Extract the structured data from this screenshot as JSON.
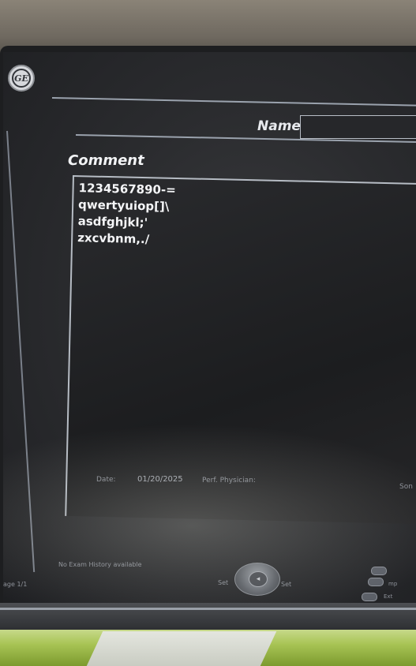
{
  "header": {
    "name_label": "Name",
    "name_value": ""
  },
  "comment": {
    "label": "Comment",
    "lines": "1234567890-=\nqwertyuiop[]\\\nasdfghjkl;'\nzxcvbnm,./"
  },
  "footer": {
    "date_label": "Date:",
    "date_value": "01/20/2025",
    "physician_label": "Perf. Physician:",
    "sono_label": "Son",
    "history_text": "No Exam History available",
    "page_text": "age 1/1",
    "nav_left": "Set",
    "nav_right": "Set",
    "side_label": "mp",
    "side_label2": "Ext"
  },
  "icons": [
    "ge-logo",
    "trackball-icon"
  ]
}
